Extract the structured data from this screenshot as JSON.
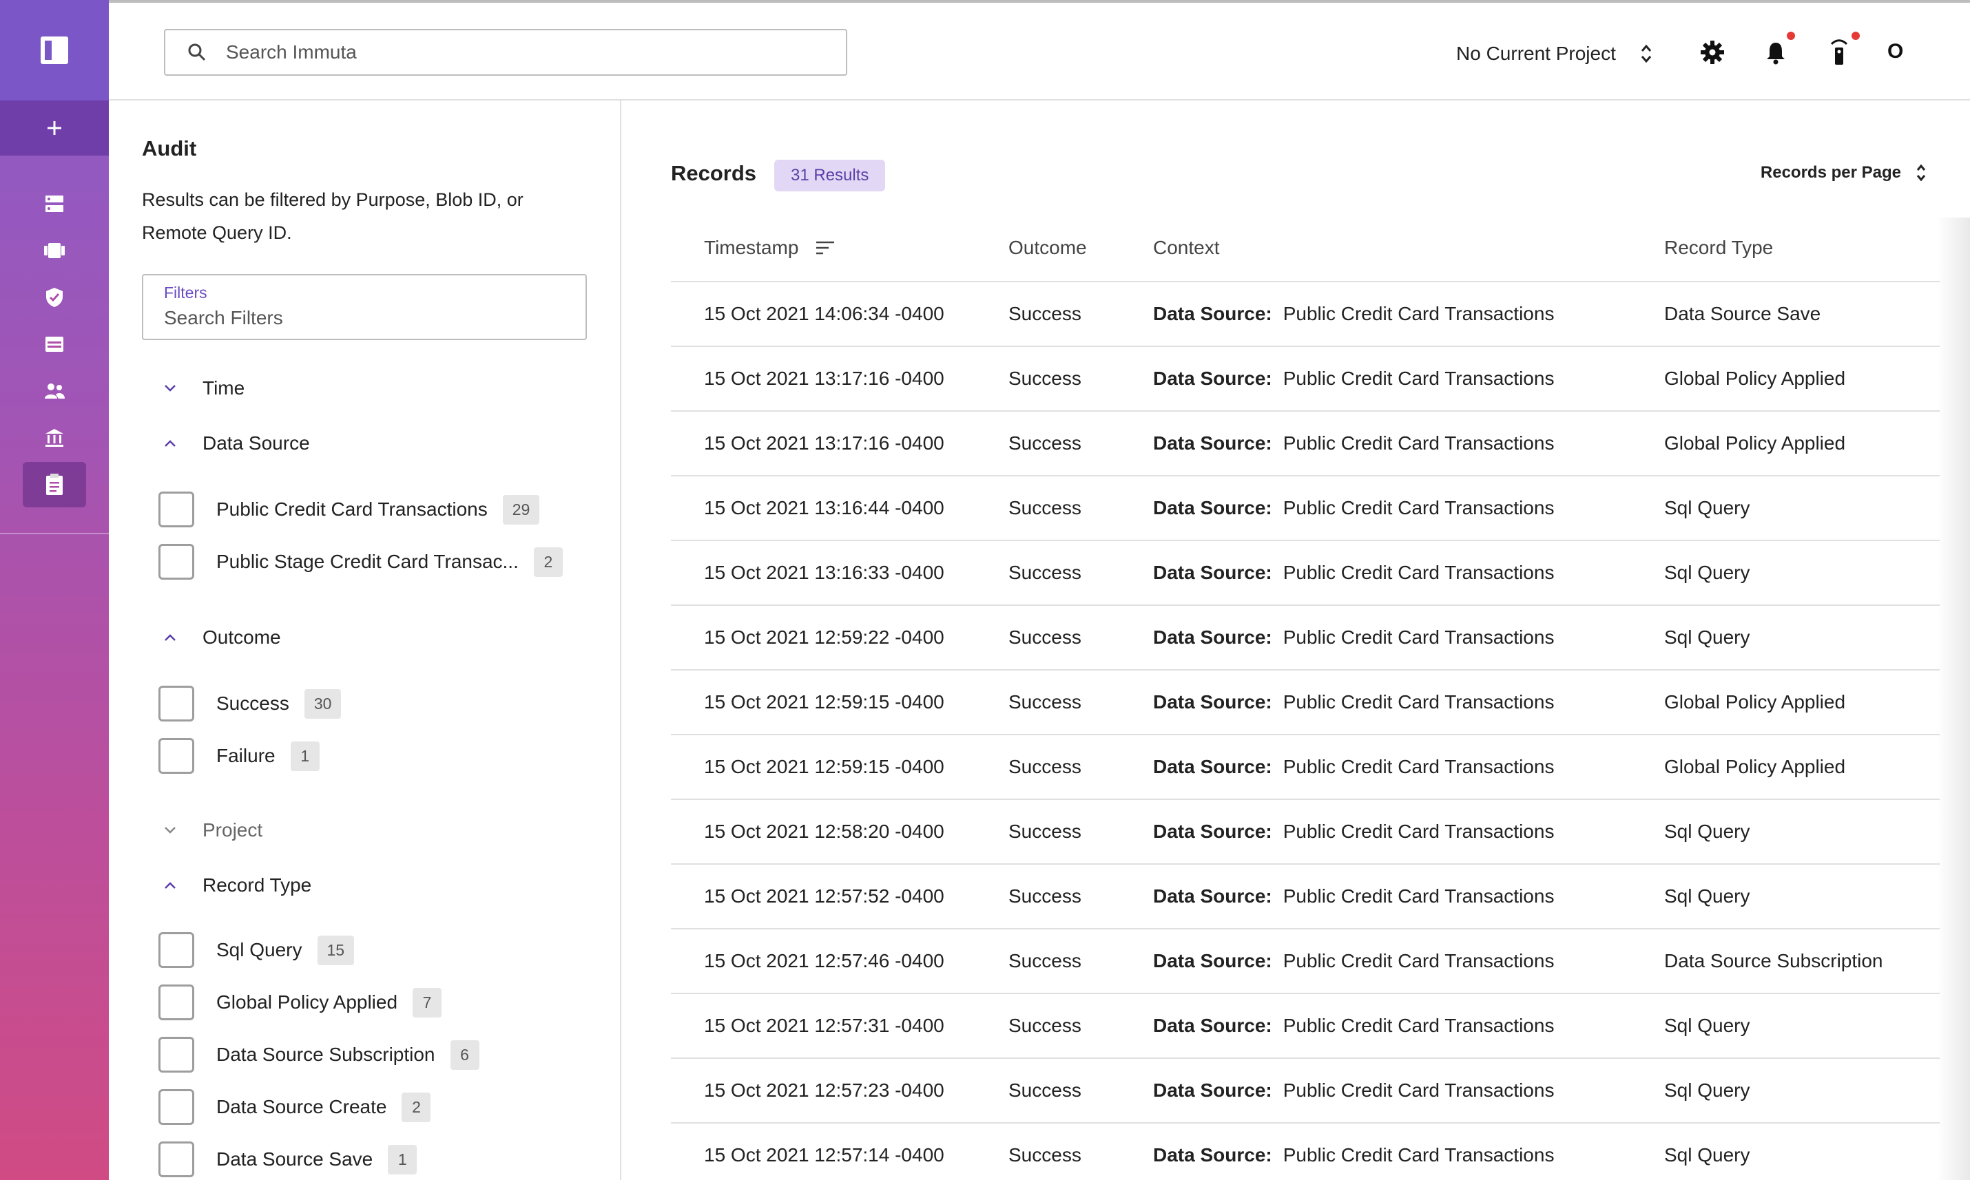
{
  "header": {
    "search_placeholder": "Search Immuta",
    "project_label": "No Current Project",
    "avatar_letter": "O",
    "icons": [
      "search-icon",
      "unfold-icon",
      "gear-icon",
      "bell-icon",
      "remote-icon"
    ]
  },
  "sidebar": {
    "items": [
      {
        "name": "data-sources",
        "icon": "database-icon"
      },
      {
        "name": "projects",
        "icon": "projects-icon"
      },
      {
        "name": "policies",
        "icon": "shield-icon"
      },
      {
        "name": "query-editor",
        "icon": "table-icon"
      },
      {
        "name": "people",
        "icon": "people-icon"
      },
      {
        "name": "governance",
        "icon": "bank-icon"
      },
      {
        "name": "audit",
        "icon": "clipboard-icon",
        "active": true
      }
    ],
    "accent": "#7a56c6"
  },
  "filters": {
    "title": "Audit",
    "description": "Results can be filtered by Purpose, Blob ID, or Remote Query ID.",
    "field_label": "Filters",
    "field_placeholder": "Search Filters",
    "sections": {
      "time": "Time",
      "data_source": "Data Source",
      "outcome": "Outcome",
      "project": "Project",
      "record_type": "Record Type"
    },
    "data_source_options": [
      {
        "label": "Public Credit Card Transactions",
        "count": "29"
      },
      {
        "label": "Public Stage Credit Card Transac...",
        "count": "2"
      }
    ],
    "outcome_options": [
      {
        "label": "Success",
        "count": "30"
      },
      {
        "label": "Failure",
        "count": "1"
      }
    ],
    "record_type_options": [
      {
        "label": "Sql Query",
        "count": "15"
      },
      {
        "label": "Global Policy Applied",
        "count": "7"
      },
      {
        "label": "Data Source Subscription",
        "count": "6"
      },
      {
        "label": "Data Source Create",
        "count": "2"
      },
      {
        "label": "Data Source Save",
        "count": "1"
      }
    ]
  },
  "records": {
    "title": "Records",
    "results_badge": "31 Results",
    "per_page_label": "Records per Page",
    "columns": [
      "Timestamp",
      "Outcome",
      "Context",
      "Record Type"
    ],
    "context_key": "Data Source:",
    "rows": [
      {
        "ts": "15 Oct 2021 14:06:34 -0400",
        "outcome": "Success",
        "context": "Public Credit Card Transactions",
        "type": "Data Source Save"
      },
      {
        "ts": "15 Oct 2021 13:17:16 -0400",
        "outcome": "Success",
        "context": "Public Credit Card Transactions",
        "type": "Global Policy Applied"
      },
      {
        "ts": "15 Oct 2021 13:17:16 -0400",
        "outcome": "Success",
        "context": "Public Credit Card Transactions",
        "type": "Global Policy Applied"
      },
      {
        "ts": "15 Oct 2021 13:16:44 -0400",
        "outcome": "Success",
        "context": "Public Credit Card Transactions",
        "type": "Sql Query"
      },
      {
        "ts": "15 Oct 2021 13:16:33 -0400",
        "outcome": "Success",
        "context": "Public Credit Card Transactions",
        "type": "Sql Query"
      },
      {
        "ts": "15 Oct 2021 12:59:22 -0400",
        "outcome": "Success",
        "context": "Public Credit Card Transactions",
        "type": "Sql Query"
      },
      {
        "ts": "15 Oct 2021 12:59:15 -0400",
        "outcome": "Success",
        "context": "Public Credit Card Transactions",
        "type": "Global Policy Applied"
      },
      {
        "ts": "15 Oct 2021 12:59:15 -0400",
        "outcome": "Success",
        "context": "Public Credit Card Transactions",
        "type": "Global Policy Applied"
      },
      {
        "ts": "15 Oct 2021 12:58:20 -0400",
        "outcome": "Success",
        "context": "Public Credit Card Transactions",
        "type": "Sql Query"
      },
      {
        "ts": "15 Oct 2021 12:57:52 -0400",
        "outcome": "Success",
        "context": "Public Credit Card Transactions",
        "type": "Sql Query"
      },
      {
        "ts": "15 Oct 2021 12:57:46 -0400",
        "outcome": "Success",
        "context": "Public Credit Card Transactions",
        "type": "Data Source Subscription"
      },
      {
        "ts": "15 Oct 2021 12:57:31 -0400",
        "outcome": "Success",
        "context": "Public Credit Card Transactions",
        "type": "Sql Query"
      },
      {
        "ts": "15 Oct 2021 12:57:23 -0400",
        "outcome": "Success",
        "context": "Public Credit Card Transactions",
        "type": "Sql Query"
      },
      {
        "ts": "15 Oct 2021 12:57:14 -0400",
        "outcome": "Success",
        "context": "Public Credit Card Transactions",
        "type": "Sql Query"
      }
    ]
  }
}
